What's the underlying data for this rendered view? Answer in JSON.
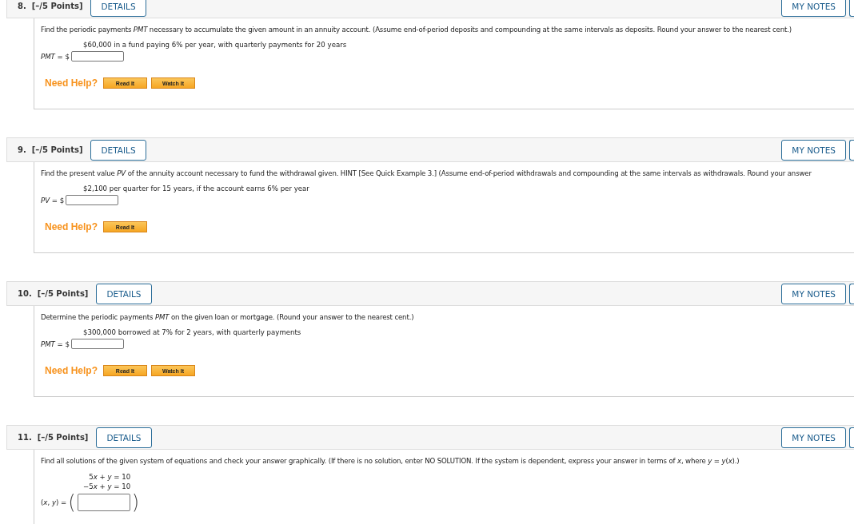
{
  "questions": [
    {
      "number": "8.",
      "points": "[–/5 Points]",
      "details_button": "DETAILS",
      "notes_button": "MY NOTES",
      "prompt": "Find the periodic payments *PMT* necessary to accumulate the given amount in an annuity account. (Assume end-of-period deposits and compounding at the same intervals as deposits. Round your answer to the nearest cent.)",
      "given": [
        "$60,000 in a fund paying 6% per year, with quarterly payments for 20 years"
      ],
      "answer": {
        "kind": "money",
        "label": "*PMT* = $"
      },
      "help": {
        "label": "Need Help?",
        "buttons": [
          "Read It",
          "Watch It"
        ]
      }
    },
    {
      "number": "9.",
      "points": "[–/5 Points]",
      "details_button": "DETAILS",
      "notes_button": "MY NOTES",
      "prompt": "Find the present value *PV* of the annuity account necessary to fund the withdrawal given. HINT [See Quick Example 3.] (Assume end-of-period withdrawals and compounding at the same intervals as withdrawals. Round your answer",
      "given": [
        "$2,100 per quarter for 15 years, if the account earns 6% per year"
      ],
      "answer": {
        "kind": "money",
        "label": "*PV* = $"
      },
      "help": {
        "label": "Need Help?",
        "buttons": [
          "Read It"
        ]
      }
    },
    {
      "number": "10.",
      "points": "[–/5 Points]",
      "details_button": "DETAILS",
      "notes_button": "MY NOTES",
      "prompt": "Determine the periodic payments *PMT* on the given loan or mortgage. (Round your answer to the nearest cent.)",
      "given": [
        "$300,000 borrowed at 7% for 2 years, with quarterly payments"
      ],
      "answer": {
        "kind": "money",
        "label": "*PMT* = $"
      },
      "help": {
        "label": "Need Help?",
        "buttons": [
          "Read It",
          "Watch It"
        ]
      }
    },
    {
      "number": "11.",
      "points": "[–/5 Points]",
      "details_button": "DETAILS",
      "notes_button": "MY NOTES",
      "prompt": "Find all solutions of the given system of equations and check your answer graphically. (If there is no solution, enter NO SOLUTION. If the system is dependent, express your answer in terms of *x*, where *y* = *y*(*x*).)",
      "equations": [
        {
          "coefficient": "5",
          "variable": "x",
          "rest": " + *y* = 10"
        },
        {
          "coefficient": "−5",
          "variable": "x",
          "rest": " + *y* = 10"
        }
      ],
      "answer": {
        "kind": "pair",
        "label": "(*x*, *y*) =",
        "open": "(",
        "close": ")"
      }
    }
  ]
}
